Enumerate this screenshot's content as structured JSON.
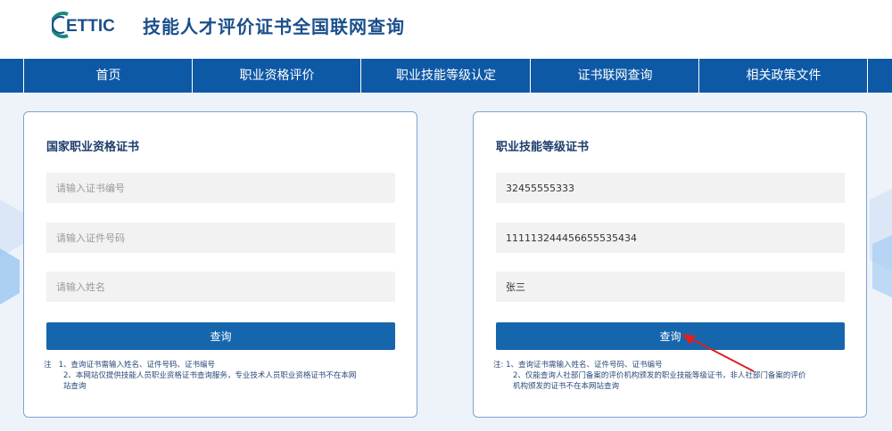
{
  "header": {
    "logo_text": "ETTIC",
    "title": "技能人才评价证书全国联网查询"
  },
  "nav": {
    "items": [
      {
        "label": "首页"
      },
      {
        "label": "职业资格评价"
      },
      {
        "label": "职业技能等级认定"
      },
      {
        "label": "证书联网查询"
      },
      {
        "label": "相关政策文件"
      }
    ]
  },
  "left_card": {
    "title": "国家职业资格证书",
    "fields": [
      {
        "value": "",
        "placeholder": "请输入证书编号"
      },
      {
        "value": "",
        "placeholder": "请输入证件号码"
      },
      {
        "value": "",
        "placeholder": "请输入姓名"
      }
    ],
    "button_label": "查询",
    "note_prefix": "注",
    "note_line1": "1、查询证书需输入姓名、证件号码、证书编号",
    "note_line2": "2、本网站仅提供技能人员职业资格证书查询服务，专业技术人员职业资格证书不在本网",
    "note_line3": "站查询"
  },
  "right_card": {
    "title": "职业技能等级证书",
    "fields": [
      {
        "value": "32455555333",
        "placeholder": ""
      },
      {
        "value": "111113244456655535434",
        "placeholder": ""
      },
      {
        "value": "张三",
        "placeholder": ""
      }
    ],
    "button_label": "查询",
    "note_prefix": "注:",
    "note_line1": "1、查询证书需输入姓名、证件号码、证书编号",
    "note_line2": "2、仅能查询人社部门备案的评价机构颁发的职业技能等级证书，非人社部门备案的评价",
    "note_line3": "机构颁发的证书不在本网站查询"
  },
  "colors": {
    "nav_bg": "#0e59a6",
    "button_bg": "#1666ad",
    "title_color": "#1a4f8c",
    "card_border": "#7ba4d4",
    "arrow_color": "#e02020"
  }
}
